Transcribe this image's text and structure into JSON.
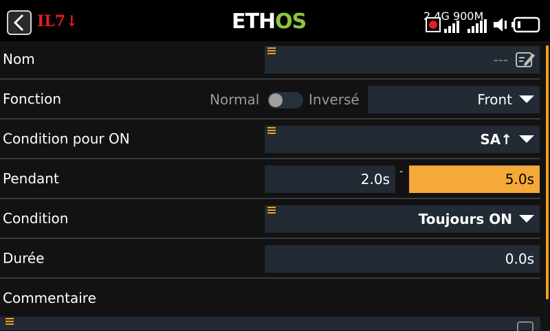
{
  "header": {
    "logical_switch": "IL7↓",
    "logo_part1": "ETH",
    "logo_part2": "OS",
    "rx_band_1": "2.4G",
    "rx_band_2": "900M"
  },
  "rows": {
    "nom": {
      "label": "Nom",
      "value": "---"
    },
    "fonction": {
      "label": "Fonction",
      "normal": "Normal",
      "inverse": "Inversé",
      "value": "Front"
    },
    "condition_on": {
      "label": "Condition pour ON",
      "value": "SA↑"
    },
    "pendant": {
      "label": "Pendant",
      "min": "2.0s",
      "separator": "-",
      "max": "5.0s"
    },
    "condition": {
      "label": "Condition",
      "value": "Toujours ON"
    },
    "duree": {
      "label": "Durée",
      "value": "0.0s"
    },
    "commentaire": {
      "label": "Commentaire"
    }
  },
  "colors": {
    "accent": "#f0a020",
    "field_bg": "#222a33",
    "logo_green": "#8dc63f",
    "alert_red": "#e02020"
  },
  "icons": [
    "back-icon",
    "record-icon",
    "signal-bars-icon",
    "speaker-icon",
    "battery-icon",
    "edit-icon",
    "drag-handle-icon",
    "dropdown-arrow-icon"
  ]
}
